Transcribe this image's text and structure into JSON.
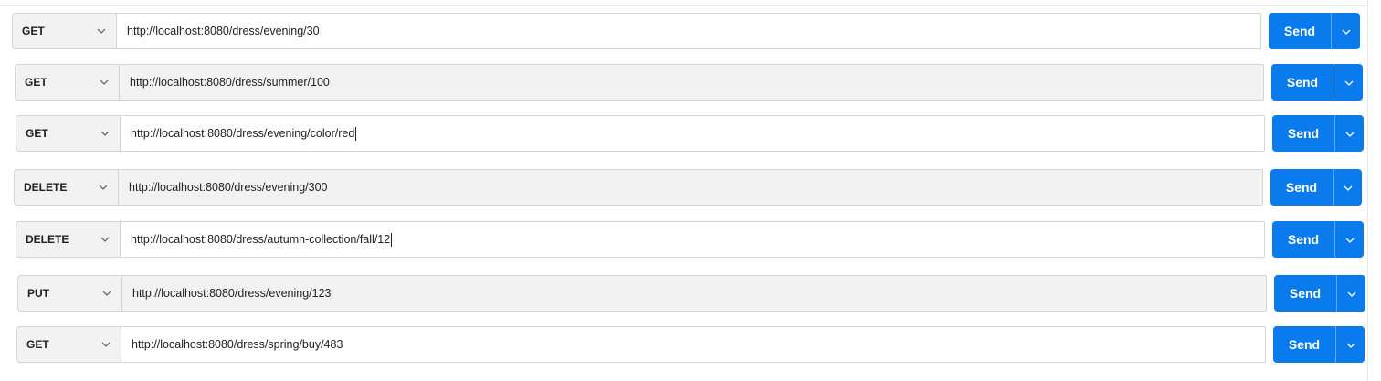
{
  "requests": [
    {
      "method": "GET",
      "url": "http://localhost:8080/dress/evening/30",
      "send_label": "Send",
      "url_bg": "white",
      "caret": false
    },
    {
      "method": "GET",
      "url": "http://localhost:8080/dress/summer/100",
      "send_label": "Send",
      "url_bg": "filled",
      "caret": false
    },
    {
      "method": "GET",
      "url": "http://localhost:8080/dress/evening/color/red",
      "send_label": "Send",
      "url_bg": "white",
      "caret": true
    },
    {
      "method": "DELETE",
      "url": "http://localhost:8080/dress/evening/300",
      "send_label": "Send",
      "url_bg": "filled",
      "caret": false
    },
    {
      "method": "DELETE",
      "url": "http://localhost:8080/dress/autumn-collection/fall/12",
      "send_label": "Send",
      "url_bg": "white",
      "caret": true
    },
    {
      "method": "PUT",
      "url": "http://localhost:8080/dress/evening/123",
      "send_label": "Send",
      "url_bg": "filled",
      "caret": false
    },
    {
      "method": "GET",
      "url": "http://localhost:8080/dress/spring/buy/483",
      "send_label": "Send",
      "url_bg": "white",
      "caret": false
    }
  ],
  "colors": {
    "send_button": "#097bed",
    "method_bg": "#f2f2f2",
    "border": "#d4d4d4"
  },
  "icons": {
    "method_dropdown": "chevron-down-icon",
    "send_dropdown": "chevron-down-icon"
  }
}
